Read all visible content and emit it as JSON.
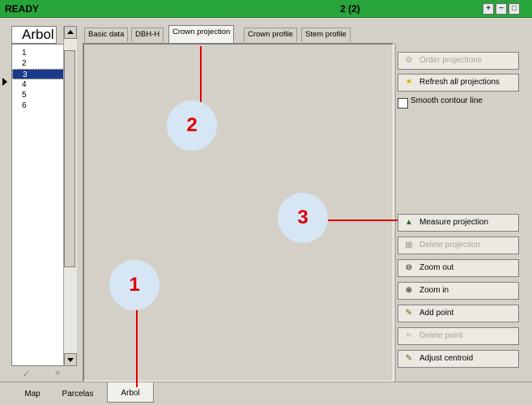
{
  "status": {
    "text": "READY",
    "count": "2 (2)",
    "buttons": [
      "+",
      "−",
      "□"
    ]
  },
  "left": {
    "header": "Arbol",
    "items": [
      "1",
      "2",
      "3",
      "4",
      "5",
      "6"
    ],
    "selected_index": 2,
    "footer": [
      "✓",
      "×"
    ]
  },
  "top_tabs": [
    "Basic data",
    "DBH-H",
    "Crown projection",
    "Crown profile",
    "Stem profile"
  ],
  "active_top_tab": "Crown projection",
  "bottom_tabs": [
    "Map",
    "Parcelas",
    "Arbol"
  ],
  "active_bottom_tab": "Arbol",
  "right_panel": {
    "order_projections": "Order projections",
    "refresh_all": "Refresh all projections",
    "smooth_contour": "Smooth contour line",
    "measure_projection": "Measure projection",
    "delete_projection": "Delete projection",
    "zoom_out": "Zoom out",
    "zoom_in": "Zoom in",
    "add_point": "Add point",
    "delete_point": "Delete point",
    "adjust_centroid": "Adjust centroid"
  },
  "annotations": [
    "1",
    "2",
    "3"
  ],
  "colors": {
    "status_bg": "#27a53a",
    "annotation_text": "#e00000",
    "callout_bg": "#d6e6f5",
    "selection": "#1b3a8c"
  }
}
